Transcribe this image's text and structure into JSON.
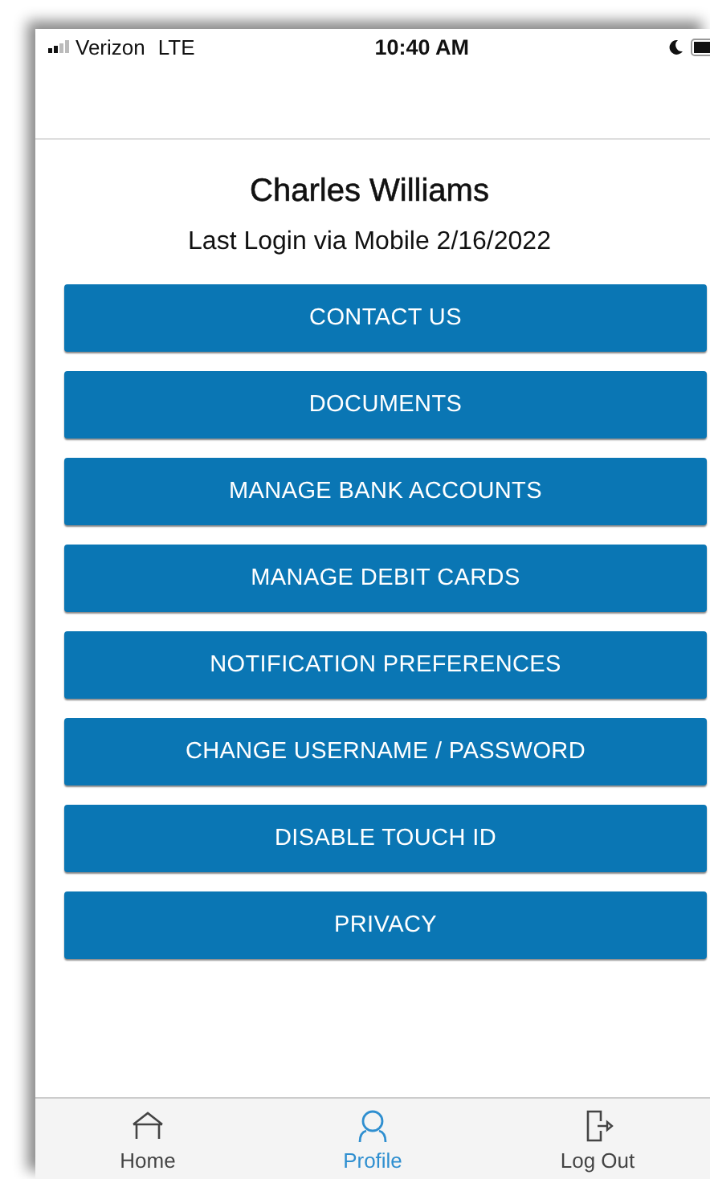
{
  "status_bar": {
    "carrier": "Verizon",
    "network": "LTE",
    "time": "10:40 AM"
  },
  "profile": {
    "name": "Charles Williams",
    "last_login": "Last Login via Mobile 2/16/2022"
  },
  "menu_buttons": [
    "CONTACT US",
    "DOCUMENTS",
    "MANAGE BANK ACCOUNTS",
    "MANAGE DEBIT CARDS",
    "NOTIFICATION PREFERENCES",
    "CHANGE USERNAME / PASSWORD",
    "DISABLE TOUCH ID",
    "PRIVACY"
  ],
  "tab_bar": [
    {
      "label": "Home",
      "kind": "home",
      "selected": false
    },
    {
      "label": "Profile",
      "kind": "profile",
      "selected": true
    },
    {
      "label": "Log Out",
      "kind": "logout",
      "selected": false
    }
  ]
}
